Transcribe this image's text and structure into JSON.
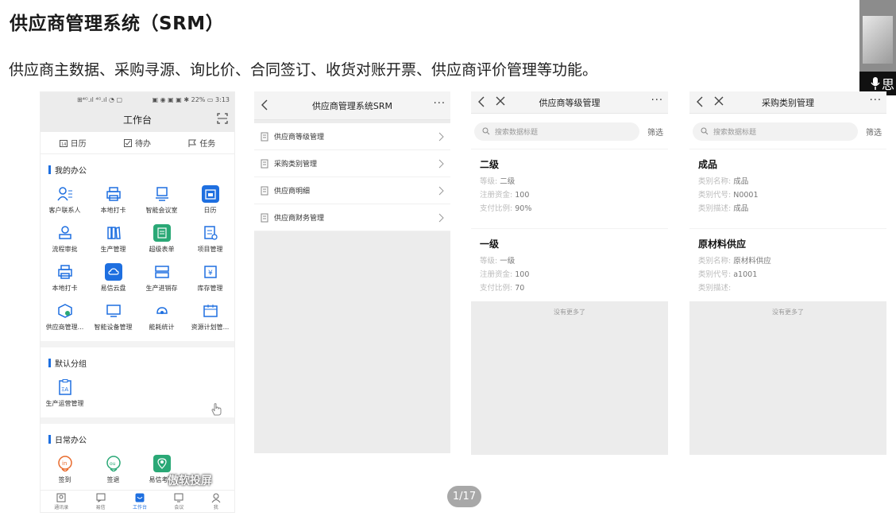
{
  "slide": {
    "title": "供应商管理系统（SRM）",
    "subtitle": "供应商主数据、采购寻源、询比价、合同签订、收货对账开票、供应商评价管理等功能。",
    "pager": "1/17"
  },
  "cam": {
    "label": "思"
  },
  "phone1": {
    "status_left": "⊞⁴ᴳ.ıl ⁴ᴳ.ıl ◔ ▢",
    "status_right": "▣ ◉ ▣ ▣ ✱ 22% ▭ 3:13",
    "header_title": "工作台",
    "quick": [
      "日历",
      "待办",
      "任务"
    ],
    "section1": "我的办公",
    "apps1": [
      {
        "label": "客户联系人",
        "icon": "contacts-icon"
      },
      {
        "label": "本地打卡",
        "icon": "clock-in-icon"
      },
      {
        "label": "智能会议室",
        "icon": "meeting-room-icon"
      },
      {
        "label": "日历",
        "icon": "calendar-icon"
      },
      {
        "label": "流程审批",
        "icon": "approval-icon"
      },
      {
        "label": "生产管理",
        "icon": "production-icon"
      },
      {
        "label": "超级表单",
        "icon": "super-form-icon"
      },
      {
        "label": "项目管理",
        "icon": "project-icon"
      },
      {
        "label": "本地打卡",
        "icon": "clock-in-icon"
      },
      {
        "label": "易信云盘",
        "icon": "cloud-disk-icon"
      },
      {
        "label": "生产进销存",
        "icon": "inventory-icon"
      },
      {
        "label": "库存管理",
        "icon": "stock-icon"
      },
      {
        "label": "供应商管理...",
        "icon": "supplier-icon"
      },
      {
        "label": "智能设备管理",
        "icon": "device-icon"
      },
      {
        "label": "能耗统计",
        "icon": "energy-icon"
      },
      {
        "label": "资源计划管...",
        "icon": "resource-plan-icon"
      }
    ],
    "section2": "默认分组",
    "apps2": [
      {
        "label": "生产运营管理",
        "icon": "operations-icon"
      }
    ],
    "section3": "日常办公",
    "apps3": [
      {
        "label": "签到",
        "icon": "sign-in-icon"
      },
      {
        "label": "签退",
        "icon": "sign-out-icon"
      },
      {
        "label": "易信考勤",
        "icon": "attendance-icon"
      }
    ],
    "tabs": [
      {
        "label": "通讯录",
        "icon": "address-book-icon"
      },
      {
        "label": "易信",
        "icon": "message-icon"
      },
      {
        "label": "工作台",
        "icon": "workbench-icon"
      },
      {
        "label": "会议",
        "icon": "meeting-icon"
      },
      {
        "label": "我",
        "icon": "profile-icon"
      }
    ],
    "watermark": "傲软投屏"
  },
  "phone2": {
    "title": "供应商管理系统SRM",
    "items": [
      "供应商等级管理",
      "采购类别管理",
      "供应商明细",
      "供应商财务管理"
    ]
  },
  "phone3": {
    "title": "供应商等级管理",
    "search_placeholder": "搜索数据标题",
    "filter": "筛选",
    "cards": [
      {
        "title": "二级",
        "rows": [
          [
            "等级: ",
            "二级"
          ],
          [
            "注册资金: ",
            "100"
          ],
          [
            "支付比例: ",
            "90%"
          ]
        ]
      },
      {
        "title": "一级",
        "rows": [
          [
            "等级: ",
            "一级"
          ],
          [
            "注册资金: ",
            "100"
          ],
          [
            "支付比例: ",
            "70"
          ]
        ]
      }
    ],
    "no_more": "没有更多了"
  },
  "phone4": {
    "title": "采购类别管理",
    "search_placeholder": "搜索数据标题",
    "filter": "筛选",
    "cards": [
      {
        "title": "成品",
        "rows": [
          [
            "类别名称: ",
            "成品"
          ],
          [
            "类别代号: ",
            "N0001"
          ],
          [
            "类别描述: ",
            "成品"
          ]
        ]
      },
      {
        "title": "原材料供应",
        "rows": [
          [
            "类别名称: ",
            "原材料供应"
          ],
          [
            "类别代号: ",
            "a1001"
          ],
          [
            "类别描述: ",
            ""
          ]
        ]
      }
    ],
    "no_more": "没有更多了"
  },
  "colors": {
    "accent": "#1e6fe0",
    "warm": "#e86a2c",
    "green": "#2aa876"
  }
}
